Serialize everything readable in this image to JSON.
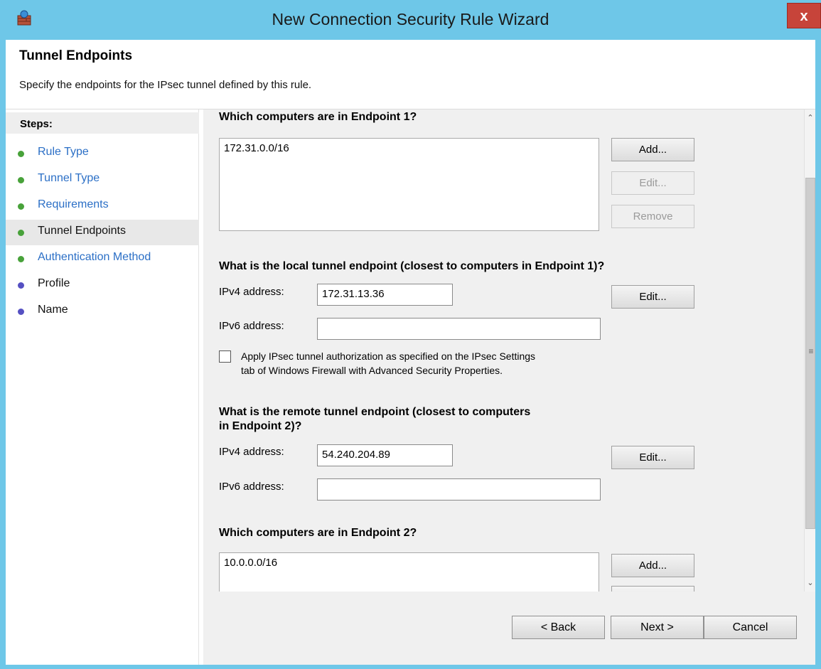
{
  "window": {
    "title": "New Connection Security Rule Wizard",
    "close_label": "x"
  },
  "header": {
    "title": "Tunnel Endpoints",
    "description": "Specify the endpoints for the IPsec tunnel defined by this rule."
  },
  "steps": {
    "heading": "Steps:",
    "items": [
      {
        "label": "Rule Type",
        "status": "completed"
      },
      {
        "label": "Tunnel Type",
        "status": "completed"
      },
      {
        "label": "Requirements",
        "status": "completed"
      },
      {
        "label": "Tunnel Endpoints",
        "status": "current"
      },
      {
        "label": "Authentication Method",
        "status": "completed"
      },
      {
        "label": "Profile",
        "status": "pending"
      },
      {
        "label": "Name",
        "status": "pending"
      }
    ]
  },
  "endpoint1": {
    "heading": "Which computers are in Endpoint 1?",
    "entries": [
      "172.31.0.0/16"
    ],
    "add_label": "Add...",
    "edit_label": "Edit...",
    "remove_label": "Remove"
  },
  "local_endpoint": {
    "heading": "What is the local tunnel endpoint (closest to computers in Endpoint 1)?",
    "ipv4_label": "IPv4 address:",
    "ipv4_value": "172.31.13.36",
    "ipv6_label": "IPv6 address:",
    "ipv6_value": "",
    "edit_label": "Edit...",
    "checkbox_line1": "Apply IPsec tunnel authorization as specified on the IPsec Settings",
    "checkbox_line2": "tab of Windows Firewall with Advanced Security Properties.",
    "checkbox_checked": false
  },
  "remote_endpoint": {
    "heading_line1": "What is the remote tunnel endpoint (closest to computers",
    "heading_line2": "in Endpoint 2)?",
    "ipv4_label": "IPv4 address:",
    "ipv4_value": "54.240.204.89",
    "ipv6_label": "IPv6 address:",
    "ipv6_value": "",
    "edit_label": "Edit..."
  },
  "endpoint2": {
    "heading": "Which computers are in Endpoint 2?",
    "entries": [
      "10.0.0.0/16"
    ],
    "add_label": "Add..."
  },
  "footer": {
    "back_label": "< Back",
    "next_label": "Next >",
    "cancel_label": "Cancel"
  },
  "colors": {
    "titlebar": "#6ec7e8",
    "close": "#c7443a",
    "link": "#2b6fc6",
    "done_dot": "#48a23a",
    "pending_dot": "#5550c2"
  }
}
